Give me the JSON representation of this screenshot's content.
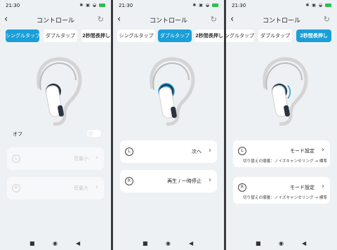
{
  "screens": [
    {
      "time": "21:30",
      "title": "コントロール",
      "tabs": [
        {
          "label": "シングルタップ",
          "active": true
        },
        {
          "label": "ダブルタップ",
          "active": false
        },
        {
          "label": "2秒間長押し",
          "active": false
        }
      ],
      "toggle_label": "オフ",
      "cards": [
        {
          "side": "L",
          "value": "音量小"
        },
        {
          "side": "R",
          "value": "音量大"
        }
      ]
    },
    {
      "time": "21:30",
      "title": "コントロール",
      "tabs": [
        {
          "label": "シングルタップ",
          "active": false
        },
        {
          "label": "ダブルタップ",
          "active": true
        },
        {
          "label": "2秒間長押し",
          "active": false
        }
      ],
      "cards": [
        {
          "side": "L",
          "value": "次へ"
        },
        {
          "side": "R",
          "value": "再生 / 一時停止"
        }
      ]
    },
    {
      "time": "21:30",
      "title": "コントロール",
      "tabs": [
        {
          "label": "シングルタップ",
          "active": false
        },
        {
          "label": "ダブルタップ",
          "active": false
        },
        {
          "label": "2秒間長押し",
          "active": true
        }
      ],
      "cards": [
        {
          "side": "L",
          "value": "モード設定",
          "sub": "切り替えの順番：ノイズキャンセリング → 標準"
        },
        {
          "side": "R",
          "value": "モード設定",
          "sub": "切り替えの順番：ノイズキャンセリング → 標準"
        }
      ]
    }
  ],
  "colors": {
    "accent": "#1a9fd8",
    "background": "#eef1f4"
  },
  "icons": {
    "back": "chevron-left-icon",
    "refresh": "refresh-icon",
    "nav": [
      "square-icon",
      "circle-icon",
      "triangle-icon"
    ]
  }
}
